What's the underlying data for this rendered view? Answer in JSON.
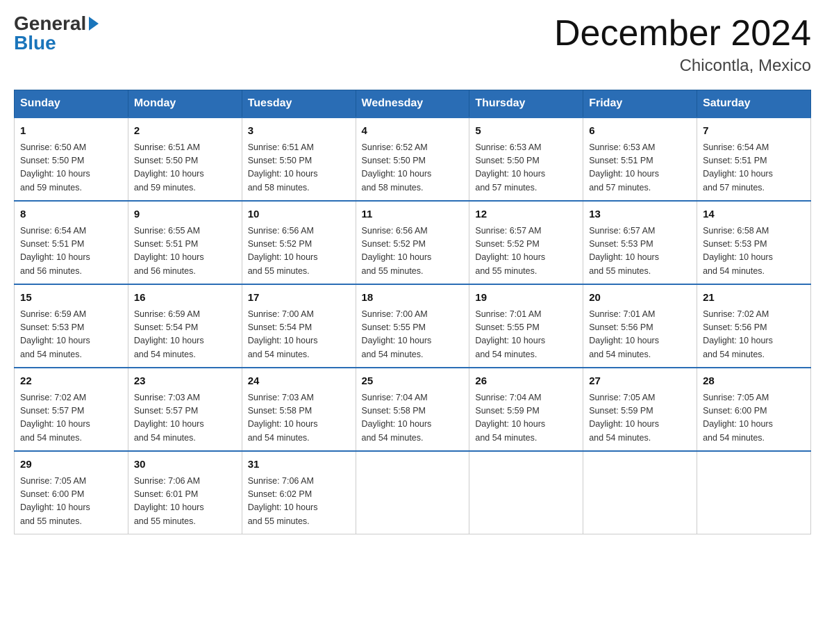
{
  "header": {
    "logo_general": "General",
    "logo_blue": "Blue",
    "month_year": "December 2024",
    "location": "Chicontla, Mexico"
  },
  "days_of_week": [
    "Sunday",
    "Monday",
    "Tuesday",
    "Wednesday",
    "Thursday",
    "Friday",
    "Saturday"
  ],
  "weeks": [
    [
      {
        "day": "1",
        "sunrise": "6:50 AM",
        "sunset": "5:50 PM",
        "daylight": "10 hours and 59 minutes."
      },
      {
        "day": "2",
        "sunrise": "6:51 AM",
        "sunset": "5:50 PM",
        "daylight": "10 hours and 59 minutes."
      },
      {
        "day": "3",
        "sunrise": "6:51 AM",
        "sunset": "5:50 PM",
        "daylight": "10 hours and 58 minutes."
      },
      {
        "day": "4",
        "sunrise": "6:52 AM",
        "sunset": "5:50 PM",
        "daylight": "10 hours and 58 minutes."
      },
      {
        "day": "5",
        "sunrise": "6:53 AM",
        "sunset": "5:50 PM",
        "daylight": "10 hours and 57 minutes."
      },
      {
        "day": "6",
        "sunrise": "6:53 AM",
        "sunset": "5:51 PM",
        "daylight": "10 hours and 57 minutes."
      },
      {
        "day": "7",
        "sunrise": "6:54 AM",
        "sunset": "5:51 PM",
        "daylight": "10 hours and 57 minutes."
      }
    ],
    [
      {
        "day": "8",
        "sunrise": "6:54 AM",
        "sunset": "5:51 PM",
        "daylight": "10 hours and 56 minutes."
      },
      {
        "day": "9",
        "sunrise": "6:55 AM",
        "sunset": "5:51 PM",
        "daylight": "10 hours and 56 minutes."
      },
      {
        "day": "10",
        "sunrise": "6:56 AM",
        "sunset": "5:52 PM",
        "daylight": "10 hours and 55 minutes."
      },
      {
        "day": "11",
        "sunrise": "6:56 AM",
        "sunset": "5:52 PM",
        "daylight": "10 hours and 55 minutes."
      },
      {
        "day": "12",
        "sunrise": "6:57 AM",
        "sunset": "5:52 PM",
        "daylight": "10 hours and 55 minutes."
      },
      {
        "day": "13",
        "sunrise": "6:57 AM",
        "sunset": "5:53 PM",
        "daylight": "10 hours and 55 minutes."
      },
      {
        "day": "14",
        "sunrise": "6:58 AM",
        "sunset": "5:53 PM",
        "daylight": "10 hours and 54 minutes."
      }
    ],
    [
      {
        "day": "15",
        "sunrise": "6:59 AM",
        "sunset": "5:53 PM",
        "daylight": "10 hours and 54 minutes."
      },
      {
        "day": "16",
        "sunrise": "6:59 AM",
        "sunset": "5:54 PM",
        "daylight": "10 hours and 54 minutes."
      },
      {
        "day": "17",
        "sunrise": "7:00 AM",
        "sunset": "5:54 PM",
        "daylight": "10 hours and 54 minutes."
      },
      {
        "day": "18",
        "sunrise": "7:00 AM",
        "sunset": "5:55 PM",
        "daylight": "10 hours and 54 minutes."
      },
      {
        "day": "19",
        "sunrise": "7:01 AM",
        "sunset": "5:55 PM",
        "daylight": "10 hours and 54 minutes."
      },
      {
        "day": "20",
        "sunrise": "7:01 AM",
        "sunset": "5:56 PM",
        "daylight": "10 hours and 54 minutes."
      },
      {
        "day": "21",
        "sunrise": "7:02 AM",
        "sunset": "5:56 PM",
        "daylight": "10 hours and 54 minutes."
      }
    ],
    [
      {
        "day": "22",
        "sunrise": "7:02 AM",
        "sunset": "5:57 PM",
        "daylight": "10 hours and 54 minutes."
      },
      {
        "day": "23",
        "sunrise": "7:03 AM",
        "sunset": "5:57 PM",
        "daylight": "10 hours and 54 minutes."
      },
      {
        "day": "24",
        "sunrise": "7:03 AM",
        "sunset": "5:58 PM",
        "daylight": "10 hours and 54 minutes."
      },
      {
        "day": "25",
        "sunrise": "7:04 AM",
        "sunset": "5:58 PM",
        "daylight": "10 hours and 54 minutes."
      },
      {
        "day": "26",
        "sunrise": "7:04 AM",
        "sunset": "5:59 PM",
        "daylight": "10 hours and 54 minutes."
      },
      {
        "day": "27",
        "sunrise": "7:05 AM",
        "sunset": "5:59 PM",
        "daylight": "10 hours and 54 minutes."
      },
      {
        "day": "28",
        "sunrise": "7:05 AM",
        "sunset": "6:00 PM",
        "daylight": "10 hours and 54 minutes."
      }
    ],
    [
      {
        "day": "29",
        "sunrise": "7:05 AM",
        "sunset": "6:00 PM",
        "daylight": "10 hours and 55 minutes."
      },
      {
        "day": "30",
        "sunrise": "7:06 AM",
        "sunset": "6:01 PM",
        "daylight": "10 hours and 55 minutes."
      },
      {
        "day": "31",
        "sunrise": "7:06 AM",
        "sunset": "6:02 PM",
        "daylight": "10 hours and 55 minutes."
      },
      null,
      null,
      null,
      null
    ]
  ],
  "labels": {
    "sunrise": "Sunrise:",
    "sunset": "Sunset:",
    "daylight": "Daylight:"
  }
}
